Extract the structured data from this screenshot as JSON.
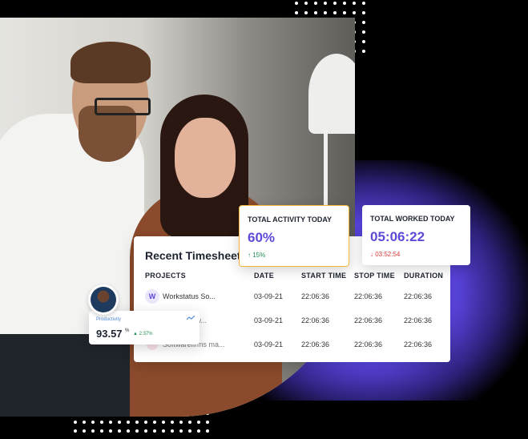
{
  "table": {
    "title": "Recent Timesheets",
    "columns": [
      "PROJECTS",
      "DATE",
      "START TIME",
      "STOP TIME",
      "DURATION"
    ],
    "rows": [
      {
        "badge": "W",
        "project": "Workstatus So...",
        "date": "03-09-21",
        "start": "22:06:36",
        "stop": "22:06:36",
        "duration": "22:06:36"
      },
      {
        "badge": "",
        "project": "...rs w...",
        "date": "03-09-21",
        "start": "22:06:36",
        "stop": "22:06:36",
        "duration": "22:06:36"
      },
      {
        "badge": "",
        "project": "Softwarefirms ma...",
        "date": "03-09-21",
        "start": "22:06:36",
        "stop": "22:06:36",
        "duration": "22:06:36"
      }
    ]
  },
  "kpis": {
    "activity": {
      "label": "TOTAL ACTIVITY TODAY",
      "value": "60%",
      "delta": "↑ 15%",
      "delta_color": "#1e8f52"
    },
    "worked": {
      "label": "TOTAL WORKED TODAY",
      "value": "05:06:22",
      "delta": "↓ 03:52:54",
      "delta_color": "#d63a3a"
    }
  },
  "productivity": {
    "label": "Productivity",
    "value": "93.57",
    "unit": "%",
    "delta": "▲ 2.37%"
  },
  "colors": {
    "accent": "#5c4bd6",
    "highlight_border": "#f3b63b",
    "glow": "#5b48e8"
  },
  "icons": {
    "trend": "trend-up-icon",
    "avatar": "user-avatar"
  }
}
